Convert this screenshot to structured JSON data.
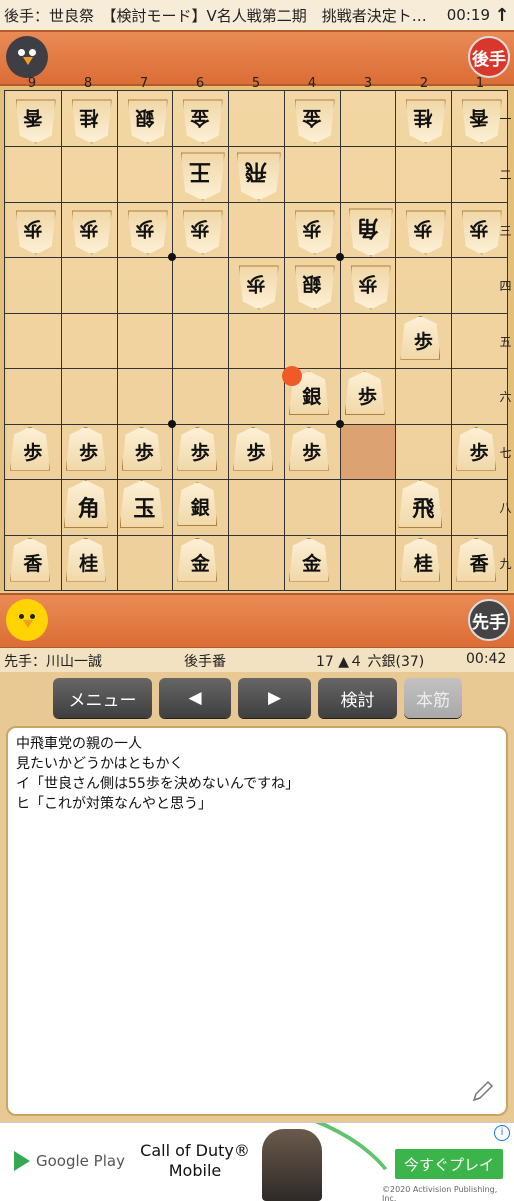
{
  "topbar": {
    "title": "後手：世良祭　【検討モード】V名人戦第二期　挑戦者決定ト…",
    "time": "00:19",
    "arrow": "↑"
  },
  "gote_badge": "後手",
  "sente_badge": "先手",
  "col_numbers": [
    "9",
    "8",
    "7",
    "6",
    "5",
    "4",
    "3",
    "2",
    "1"
  ],
  "row_numbers": [
    "一",
    "二",
    "三",
    "四",
    "五",
    "六",
    "七",
    "八",
    "九"
  ],
  "board": [
    [
      {
        "p": "香",
        "g": 1
      },
      {
        "p": "桂",
        "g": 1
      },
      {
        "p": "銀",
        "g": 1
      },
      {
        "p": "金",
        "g": 1
      },
      null,
      {
        "p": "金",
        "g": 1
      },
      null,
      {
        "p": "桂",
        "g": 1
      },
      {
        "p": "香",
        "g": 1
      }
    ],
    [
      null,
      null,
      null,
      {
        "p": "王",
        "g": 1,
        "big": 1
      },
      {
        "p": "飛",
        "g": 1,
        "big": 1
      },
      null,
      null,
      null,
      null
    ],
    [
      {
        "p": "歩",
        "g": 1
      },
      {
        "p": "歩",
        "g": 1
      },
      {
        "p": "歩",
        "g": 1
      },
      {
        "p": "歩",
        "g": 1
      },
      null,
      {
        "p": "歩",
        "g": 1
      },
      {
        "p": "角",
        "g": 1,
        "big": 1
      },
      {
        "p": "歩",
        "g": 1
      },
      {
        "p": "歩",
        "g": 1
      }
    ],
    [
      null,
      null,
      null,
      null,
      {
        "p": "歩",
        "g": 1
      },
      {
        "p": "銀",
        "g": 1
      },
      {
        "p": "歩",
        "g": 1
      },
      null,
      null
    ],
    [
      null,
      null,
      null,
      null,
      null,
      null,
      null,
      {
        "p": "歩",
        "g": 0
      },
      null
    ],
    [
      null,
      null,
      null,
      null,
      null,
      {
        "p": "銀",
        "g": 0
      },
      {
        "p": "歩",
        "g": 0
      },
      null,
      null
    ],
    [
      {
        "p": "歩",
        "g": 0
      },
      {
        "p": "歩",
        "g": 0
      },
      {
        "p": "歩",
        "g": 0
      },
      {
        "p": "歩",
        "g": 0
      },
      {
        "p": "歩",
        "g": 0
      },
      {
        "p": "歩",
        "g": 0
      },
      null,
      null,
      {
        "p": "歩",
        "g": 0
      }
    ],
    [
      null,
      {
        "p": "角",
        "g": 0,
        "big": 1
      },
      {
        "p": "玉",
        "g": 0,
        "big": 1
      },
      {
        "p": "銀",
        "g": 0
      },
      null,
      null,
      null,
      {
        "p": "飛",
        "g": 0,
        "big": 1
      },
      null
    ],
    [
      {
        "p": "香",
        "g": 0
      },
      {
        "p": "桂",
        "g": 0
      },
      null,
      {
        "p": "金",
        "g": 0
      },
      null,
      {
        "p": "金",
        "g": 0
      },
      null,
      {
        "p": "桂",
        "g": 0
      },
      {
        "p": "香",
        "g": 0
      }
    ]
  ],
  "status": {
    "sente": "先手：川山一誠",
    "turn": "後手番",
    "move": "17 ▲４ 六銀(37)",
    "time": "00:42"
  },
  "buttons": {
    "menu": "メニュー",
    "prev": "◀",
    "next": "▶",
    "analyze": "検討",
    "mainline": "本筋"
  },
  "comment_lines": [
    "中飛車党の親の一人",
    "見たいかどうかはともかく",
    "イ「世良さん側は55歩を決めないんですね」",
    "ヒ「これが対策なんやと思う」"
  ],
  "ad": {
    "store": "Google Play",
    "game_line1": "Call of Duty®",
    "game_line2": "Mobile",
    "cta": "今すぐプレイ",
    "copyright": "©2020 Activision Publishing, Inc.",
    "info": "i"
  },
  "colors": {
    "board": "#f2d49e",
    "stand": "#e07a44",
    "highlight": "#d99a6a",
    "move_dot": "#f05a28"
  }
}
